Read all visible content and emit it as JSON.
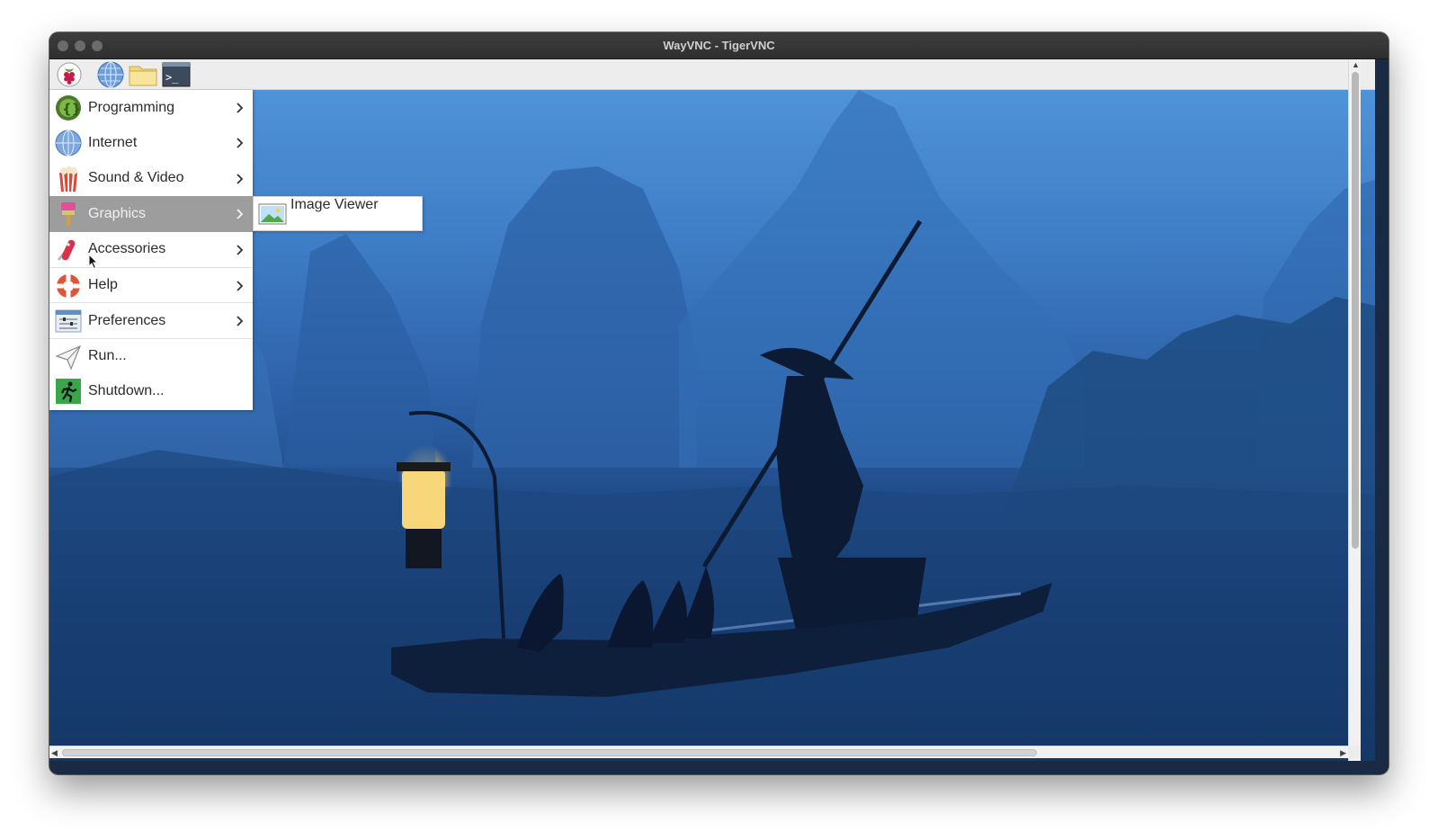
{
  "window": {
    "title": "WayVNC - TigerVNC"
  },
  "taskbar": {
    "items": [
      {
        "icon": "raspberry-icon"
      },
      {
        "icon": "globe-icon"
      },
      {
        "icon": "folder-icon"
      },
      {
        "icon": "terminal-icon",
        "text": ">_"
      }
    ]
  },
  "menu": {
    "items": [
      {
        "label": "Programming",
        "icon": "programming-icon",
        "submenu": true
      },
      {
        "label": "Internet",
        "icon": "internet-icon",
        "submenu": true
      },
      {
        "label": "Sound & Video",
        "icon": "sound-video-icon",
        "submenu": true
      },
      {
        "label": "Graphics",
        "icon": "graphics-icon",
        "submenu": true,
        "active": true
      },
      {
        "label": "Accessories",
        "icon": "accessories-icon",
        "submenu": true
      },
      {
        "label": "Help",
        "icon": "help-icon",
        "submenu": true
      },
      {
        "label": "Preferences",
        "icon": "preferences-icon",
        "submenu": true
      },
      {
        "label": "Run...",
        "icon": "run-icon",
        "submenu": false
      },
      {
        "label": "Shutdown...",
        "icon": "shutdown-icon",
        "submenu": false
      }
    ]
  },
  "submenu": {
    "items": [
      {
        "label": "Image Viewer",
        "icon": "image-viewer-icon"
      }
    ]
  },
  "colors": {
    "menu_active": "#9d9d9d",
    "titlebar": "#2f2f2f",
    "desktop_sky": "#4f93d8"
  }
}
